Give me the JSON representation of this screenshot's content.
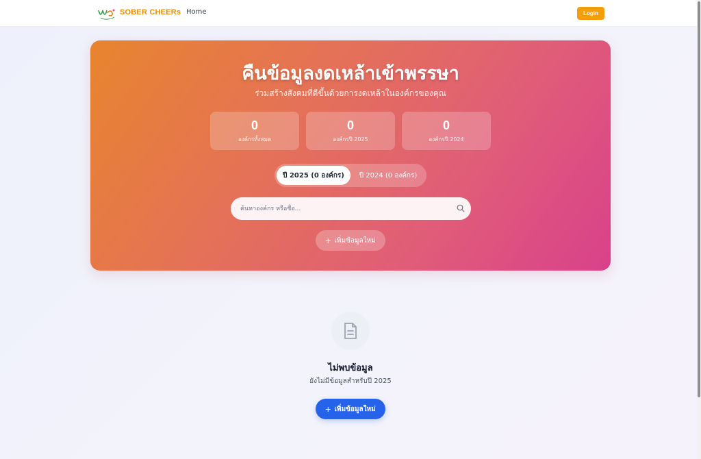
{
  "navbar": {
    "brand_name": "SOBER CHEERs",
    "home_link": "Home",
    "login_label": "Login",
    "logo_icon": "healthy-logo-icon"
  },
  "hero": {
    "title": "คืนข้อมูลงดเหล้าเข้าพรรษา",
    "subtitle": "ร่วมสร้างสังคมที่ดีขึ้นด้วยการงดเหล้าในองค์กรของคุณ",
    "stats": [
      {
        "value": "0",
        "label": "องค์กรทั้งหมด"
      },
      {
        "value": "0",
        "label": "องค์กรปี 2025"
      },
      {
        "value": "0",
        "label": "องค์กรปี 2024"
      }
    ],
    "tabs": [
      {
        "label": "ปี 2025 (0 องค์กร)",
        "active": true
      },
      {
        "label": "ปี 2024 (0 องค์กร)",
        "active": false
      }
    ],
    "search": {
      "placeholder": "ค้นหาองค์กร หรือชื่อ...",
      "icon": "search-icon"
    },
    "add_button_label": "เพิ่มข้อมูลใหม่"
  },
  "empty_state": {
    "icon": "document-icon",
    "title": "ไม่พบข้อมูล",
    "description": "ยังไม่มีข้อมูลสำหรับปี 2025",
    "add_button_label": "เพิ่มข้อมูลใหม่"
  },
  "colors": {
    "brand": "#f08c00",
    "login": "#f59e0b",
    "hero_start": "#e8852e",
    "hero_end": "#d9418b",
    "primary_button": "#2563eb"
  }
}
